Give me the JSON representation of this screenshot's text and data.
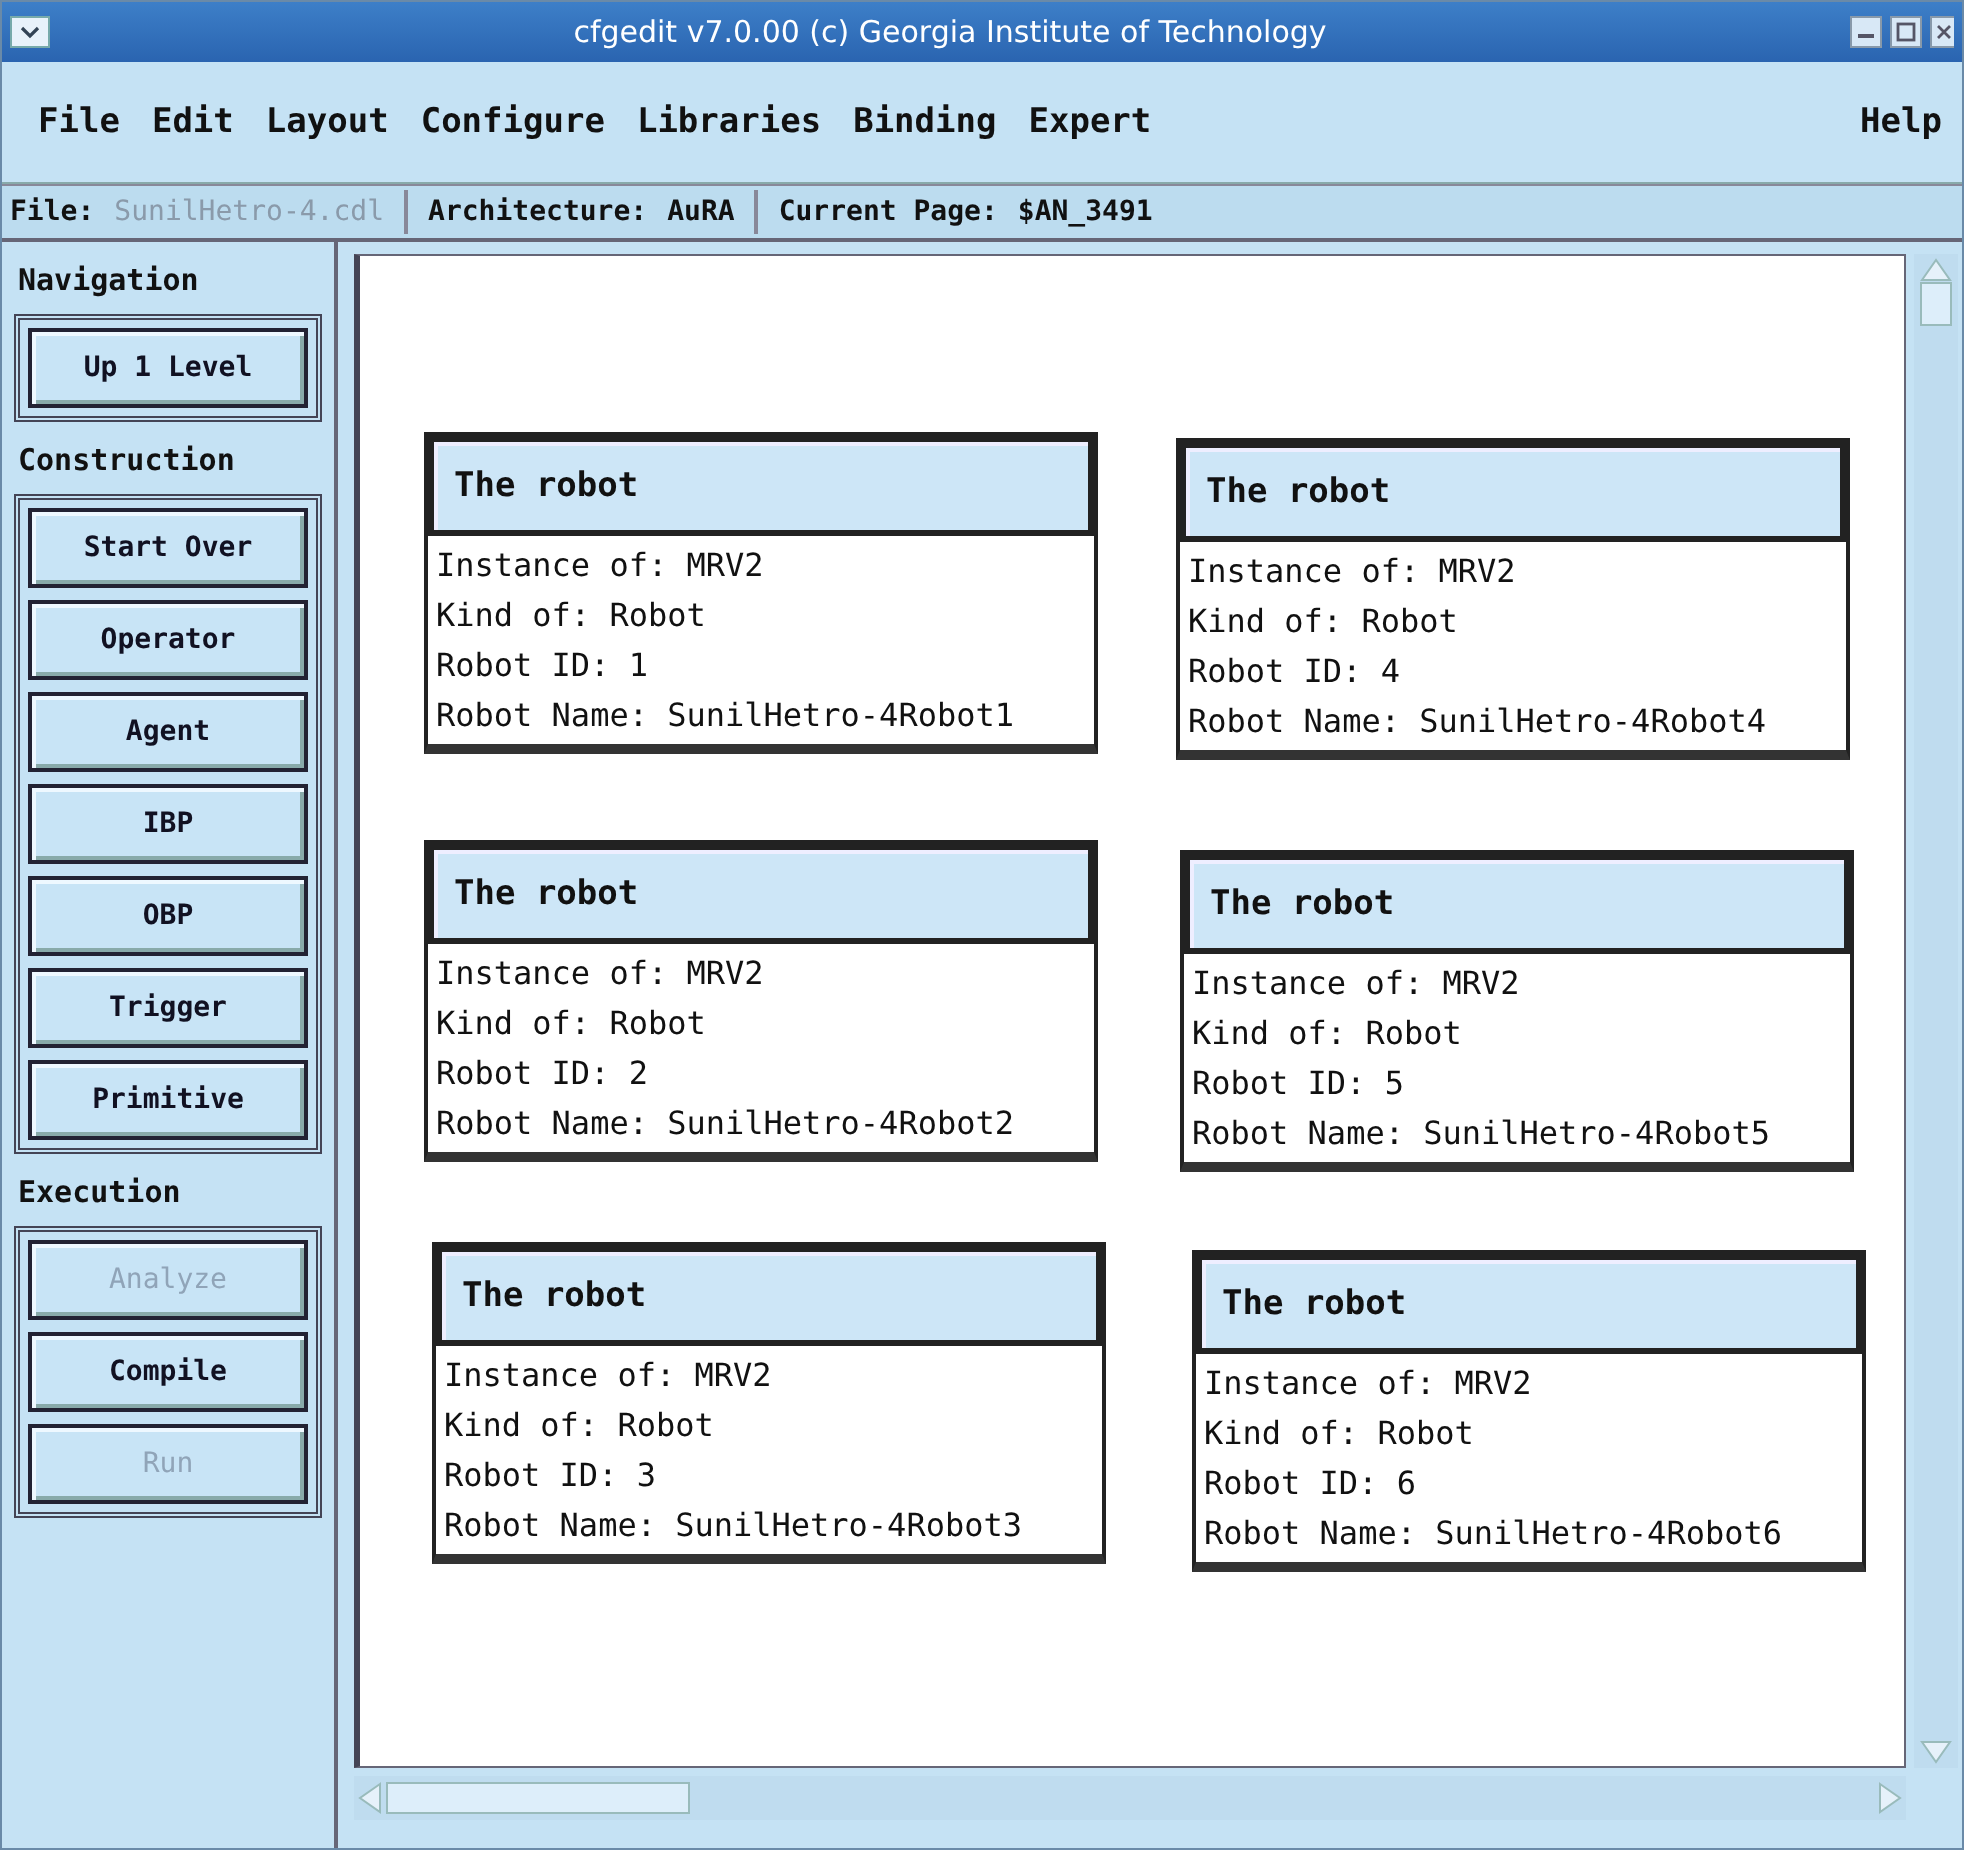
{
  "window": {
    "title": "cfgedit  v7.0.00  (c) Georgia Institute of Technology"
  },
  "menu": [
    {
      "label": "File"
    },
    {
      "label": "Edit"
    },
    {
      "label": "Layout"
    },
    {
      "label": "Configure"
    },
    {
      "label": "Libraries"
    },
    {
      "label": "Binding"
    },
    {
      "label": "Expert"
    }
  ],
  "help_menu": "Help",
  "info_bar": {
    "file_label": "File:",
    "file_value": "SunilHetro-4.cdl",
    "architecture_label": "Architecture:",
    "architecture_value": "AuRA",
    "page_label": "Current Page:",
    "page_value": "$AN_3491"
  },
  "sidebar": [
    {
      "heading": "Navigation",
      "buttons": [
        {
          "label": "Up 1 Level",
          "disabled": false
        }
      ]
    },
    {
      "heading": "Construction",
      "buttons": [
        {
          "label": "Start Over",
          "disabled": false
        },
        {
          "label": "Operator",
          "disabled": false
        },
        {
          "label": "Agent",
          "disabled": false
        },
        {
          "label": "IBP",
          "disabled": false
        },
        {
          "label": "OBP",
          "disabled": false
        },
        {
          "label": "Trigger",
          "disabled": false
        },
        {
          "label": "Primitive",
          "disabled": false
        }
      ]
    },
    {
      "heading": "Execution",
      "buttons": [
        {
          "label": "Analyze",
          "disabled": true
        },
        {
          "label": "Compile",
          "disabled": false
        },
        {
          "label": "Run",
          "disabled": true
        }
      ]
    }
  ],
  "nodes": [
    {
      "title": "The robot",
      "lines": [
        "Instance of: MRV2",
        "Kind of: Robot",
        "Robot ID: 1",
        "Robot Name: SunilHetro-4Robot1"
      ]
    },
    {
      "title": "The robot",
      "lines": [
        "Instance of: MRV2",
        "Kind of: Robot",
        "Robot ID: 2",
        "Robot Name: SunilHetro-4Robot2"
      ]
    },
    {
      "title": "The robot",
      "lines": [
        "Instance of: MRV2",
        "Kind of: Robot",
        "Robot ID: 3",
        "Robot Name: SunilHetro-4Robot3"
      ]
    },
    {
      "title": "The robot",
      "lines": [
        "Instance of: MRV2",
        "Kind of: Robot",
        "Robot ID: 4",
        "Robot Name: SunilHetro-4Robot4"
      ]
    },
    {
      "title": "The robot",
      "lines": [
        "Instance of: MRV2",
        "Kind of: Robot",
        "Robot ID: 5",
        "Robot Name: SunilHetro-4Robot5"
      ]
    },
    {
      "title": "The robot",
      "lines": [
        "Instance of: MRV2",
        "Kind of: Robot",
        "Robot ID: 6",
        "Robot Name: SunilHetro-4Robot6"
      ]
    }
  ]
}
